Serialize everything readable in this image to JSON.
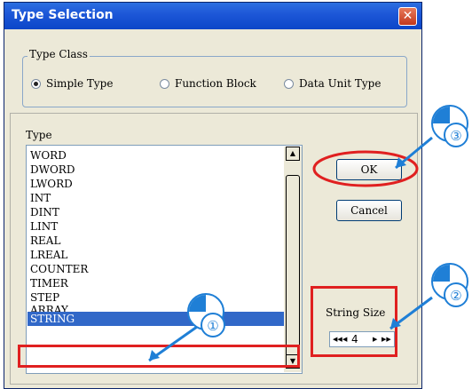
{
  "window": {
    "title": "Type Selection"
  },
  "type_class": {
    "legend": "Type Class",
    "options": [
      {
        "label": "Simple Type",
        "selected": true
      },
      {
        "label": "Function Block",
        "selected": false
      },
      {
        "label": "Data Unit Type",
        "selected": false
      }
    ]
  },
  "type_list": {
    "label": "Type",
    "items": [
      "WORD",
      "DWORD",
      "LWORD",
      "INT",
      "DINT",
      "LINT",
      "REAL",
      "LREAL",
      "COUNTER",
      "TIMER",
      "STEP",
      "ARRAY",
      "STRING"
    ],
    "selected": "STRING"
  },
  "buttons": {
    "ok": "OK",
    "cancel": "Cancel"
  },
  "string_size": {
    "label": "String Size",
    "value": "4"
  },
  "callouts": {
    "one": "①",
    "two": "②",
    "three": "③"
  },
  "colors": {
    "title_bar": "#0a46c8",
    "selection": "#3168c8",
    "highlight": "#e02020",
    "callout": "#1f7fd6"
  }
}
